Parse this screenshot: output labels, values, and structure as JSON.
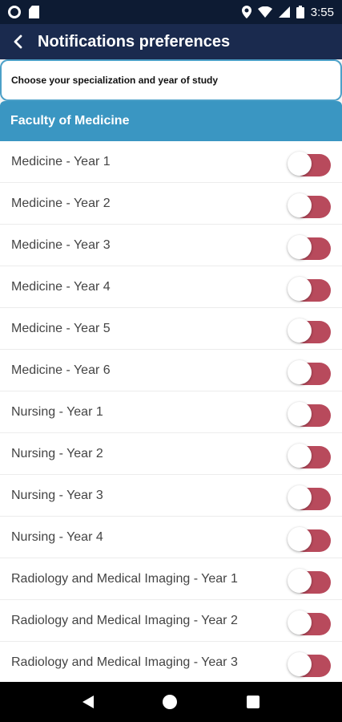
{
  "status_bar": {
    "time": "3:55"
  },
  "app_bar": {
    "title": "Notifications preferences"
  },
  "helper_text": "Choose your specialization and year of study",
  "faculty": {
    "label": "Faculty of Medicine"
  },
  "items": [
    {
      "label": "Medicine - Year 1",
      "enabled": false
    },
    {
      "label": "Medicine - Year 2",
      "enabled": false
    },
    {
      "label": "Medicine - Year 3",
      "enabled": false
    },
    {
      "label": "Medicine - Year 4",
      "enabled": false
    },
    {
      "label": "Medicine - Year 5",
      "enabled": false
    },
    {
      "label": "Medicine - Year 6",
      "enabled": false
    },
    {
      "label": "Nursing - Year 1",
      "enabled": false
    },
    {
      "label": "Nursing - Year 2",
      "enabled": false
    },
    {
      "label": "Nursing - Year 3",
      "enabled": false
    },
    {
      "label": "Nursing - Year 4",
      "enabled": false
    },
    {
      "label": "Radiology and Medical Imaging - Year 1",
      "enabled": false
    },
    {
      "label": "Radiology and Medical Imaging - Year 2",
      "enabled": false
    },
    {
      "label": "Radiology and Medical Imaging - Year 3",
      "enabled": false
    }
  ],
  "colors": {
    "app_bar": "#1a2a4e",
    "status_bar": "#0d1b33",
    "faculty_header": "#3a96c2",
    "toggle_track": "#b84a5c"
  }
}
